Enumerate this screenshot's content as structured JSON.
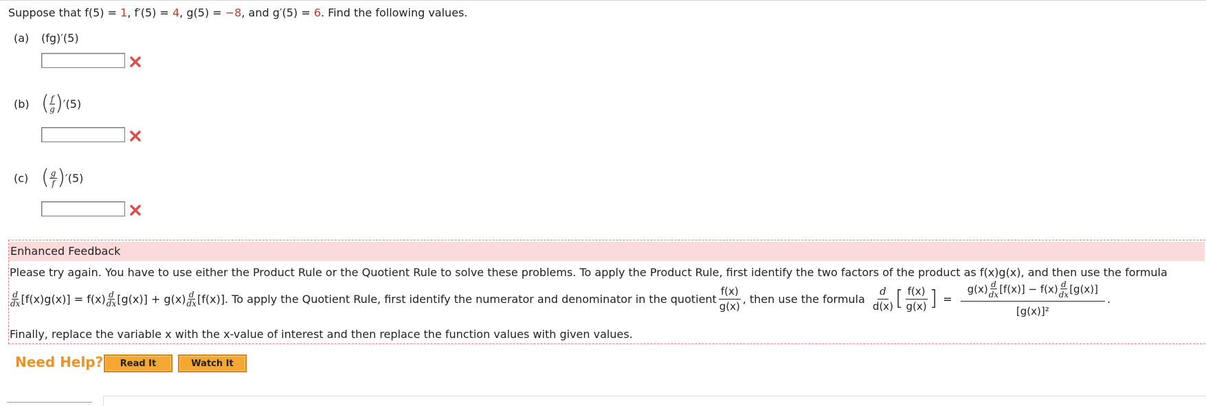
{
  "question": {
    "prefix": "Suppose that ",
    "f5": "f(5) = ",
    "f5_val": "1",
    "fp5": ", f′(5) = ",
    "fp5_val": "4",
    "g5": ", g(5) = ",
    "g5_val": "−8",
    "gp5": ", and g′(5) = ",
    "gp5_val": "6",
    "suffix": ". Find the following values."
  },
  "parts": [
    {
      "label": "(a)",
      "expr": "(fg)′(5)",
      "value": ""
    },
    {
      "label": "(b)",
      "num": "f",
      "den": "g",
      "tail": "′(5)",
      "value": ""
    },
    {
      "label": "(c)",
      "num": "g",
      "den": "f",
      "tail": "′(5)",
      "value": ""
    }
  ],
  "feedback": {
    "heading": "Enhanced Feedback",
    "line1": "Please try again. You have to use either the Product Rule or the Quotient Rule to solve these problems. To apply the Product Rule, first identify the two factors of the product as f(x)g(x), and then use the formula",
    "formula_text1": "[f(x)g(x)] = f(x)",
    "formula_text2": "[g(x)] + g(x)",
    "formula_text3": "[f(x)]. To apply the Quotient Rule, first identify the numerator and denominator in the quotient",
    "formula_text4": ", then use the formula",
    "d": "d",
    "dx": "dx",
    "dx_den": "d(x)",
    "fx": "f(x)",
    "gx": "g(x)",
    "quot_num_a": "g(x)",
    "quot_num_b": "[f(x)] − f(x)",
    "quot_num_c": "[g(x)]",
    "quot_den": "[g(x)]²",
    "equals": "=",
    "line3": "Finally, replace the variable x with the x-value of interest and then replace the function values with given values."
  },
  "help": {
    "label": "Need Help?",
    "read": "Read It",
    "watch": "Watch It"
  },
  "colors": {
    "accent": "#e8932b",
    "error": "#c0392b",
    "feedback_bg": "#fadada"
  }
}
